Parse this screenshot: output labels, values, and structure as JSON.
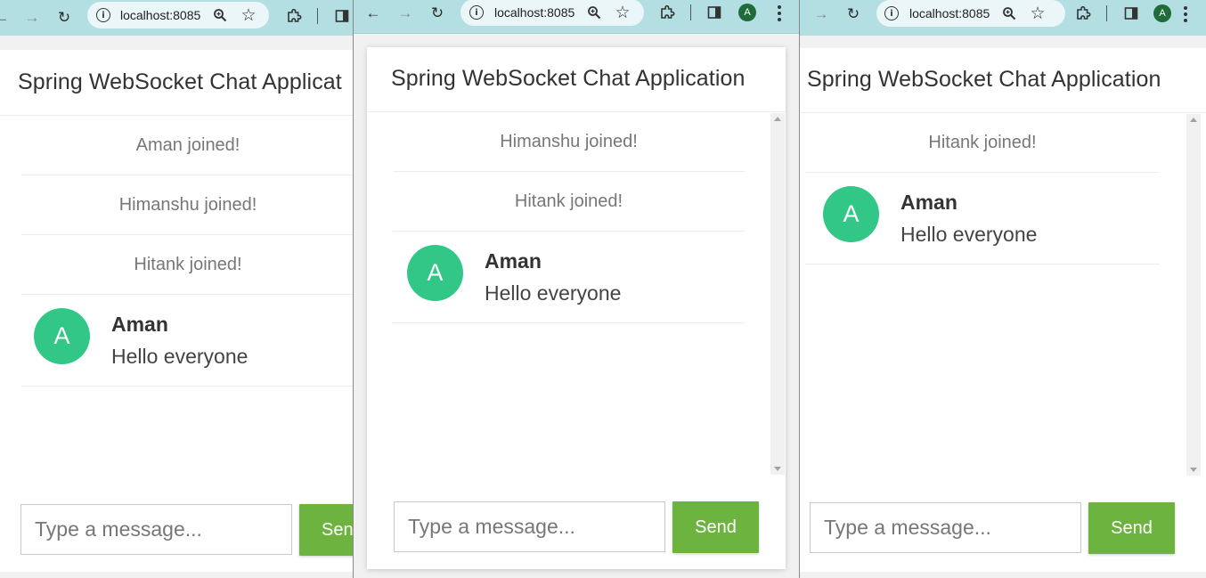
{
  "colors": {
    "toolbar_bg": "#b3dfe2",
    "avatar_bg": "#32c787",
    "send_bg": "#6db33f",
    "profile_chip_bg": "#1f6b3a"
  },
  "browser": {
    "url": "localhost:8085",
    "profile_initial": "A",
    "icons": [
      "back-arrow-icon",
      "forward-arrow-icon",
      "reload-icon",
      "info-icon",
      "zoom-icon",
      "star-icon",
      "extensions-icon",
      "side-panel-icon",
      "more-menu-icon"
    ]
  },
  "app": {
    "title": "Spring WebSocket Chat Application",
    "title_truncated": "Spring WebSocket Chat Applicat",
    "input_placeholder": "Type a message...",
    "send_label": "Send",
    "send_label_truncated": "Sen"
  },
  "windows": [
    {
      "events": [
        "Aman joined!",
        "Himanshu joined!",
        "Hitank joined!"
      ],
      "message": {
        "avatar": "A",
        "sender": "Aman",
        "text": "Hello everyone"
      }
    },
    {
      "events": [
        "Himanshu joined!",
        "Hitank joined!"
      ],
      "message": {
        "avatar": "A",
        "sender": "Aman",
        "text": "Hello everyone"
      }
    },
    {
      "events": [
        "Hitank joined!"
      ],
      "message": {
        "avatar": "A",
        "sender": "Aman",
        "text": "Hello everyone"
      }
    }
  ]
}
